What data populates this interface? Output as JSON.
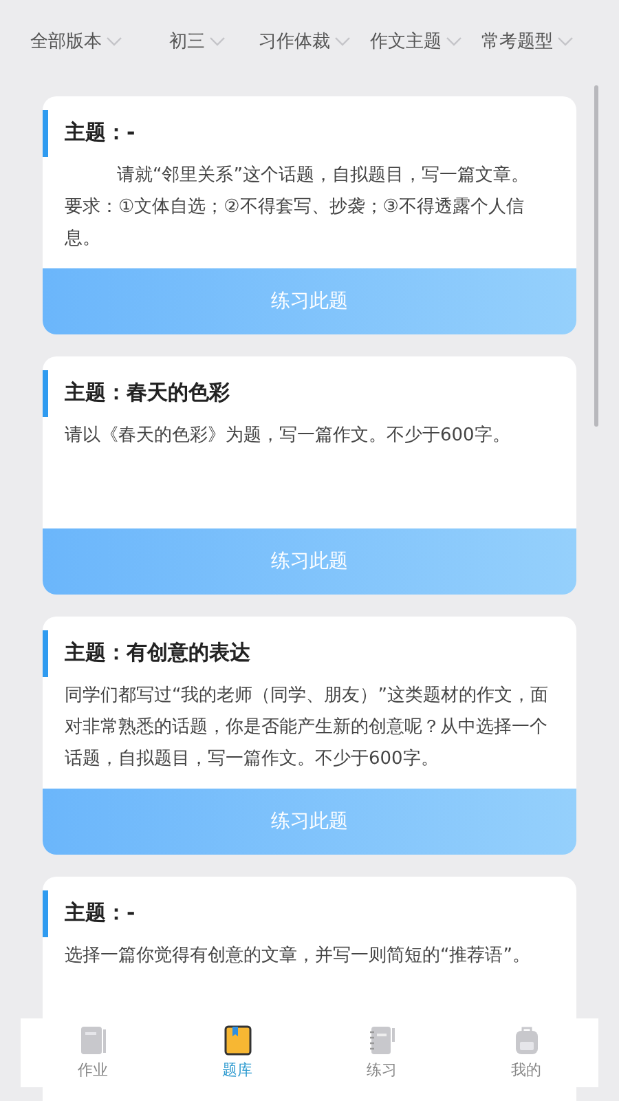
{
  "filters": [
    {
      "label": "全部版本"
    },
    {
      "label": "初三"
    },
    {
      "label": "习作体裁"
    },
    {
      "label": "作文主题"
    },
    {
      "label": "常考题型"
    }
  ],
  "cards": [
    {
      "title": "主题：-",
      "paragraphs": [
        {
          "text": "请就“邻里关系”这个话题，自拟题目，写一篇文章。",
          "indent": true
        },
        {
          "text": "要求：①文体自选；②不得套写、抄袭；③不得透露个人信息。",
          "indent": false
        }
      ],
      "button": "练习此题"
    },
    {
      "title": "主题：春天的色彩",
      "paragraphs": [
        {
          "text": "请以《春天的色彩》为题，写一篇作文。不少于600字。",
          "indent": false
        }
      ],
      "button": "练习此题"
    },
    {
      "title": "主题：有创意的表达",
      "paragraphs": [
        {
          "text": "同学们都写过“我的老师（同学、朋友）”这类题材的作文，面对非常熟悉的话题，你是否能产生新的创意呢？从中选择一个话题，自拟题目，写一篇作文。不少于600字。",
          "indent": false
        }
      ],
      "button": "练习此题"
    },
    {
      "title": "主题：-",
      "paragraphs": [
        {
          "text": "选择一篇你觉得有创意的文章，并写一则简短的“推荐语”。",
          "indent": false
        }
      ]
    }
  ],
  "tabs": [
    {
      "label": "作业",
      "kind": "book",
      "selected": false
    },
    {
      "label": "题库",
      "kind": "bank",
      "selected": true
    },
    {
      "label": "练习",
      "kind": "notebook",
      "selected": false
    },
    {
      "label": "我的",
      "kind": "bag",
      "selected": false
    }
  ]
}
